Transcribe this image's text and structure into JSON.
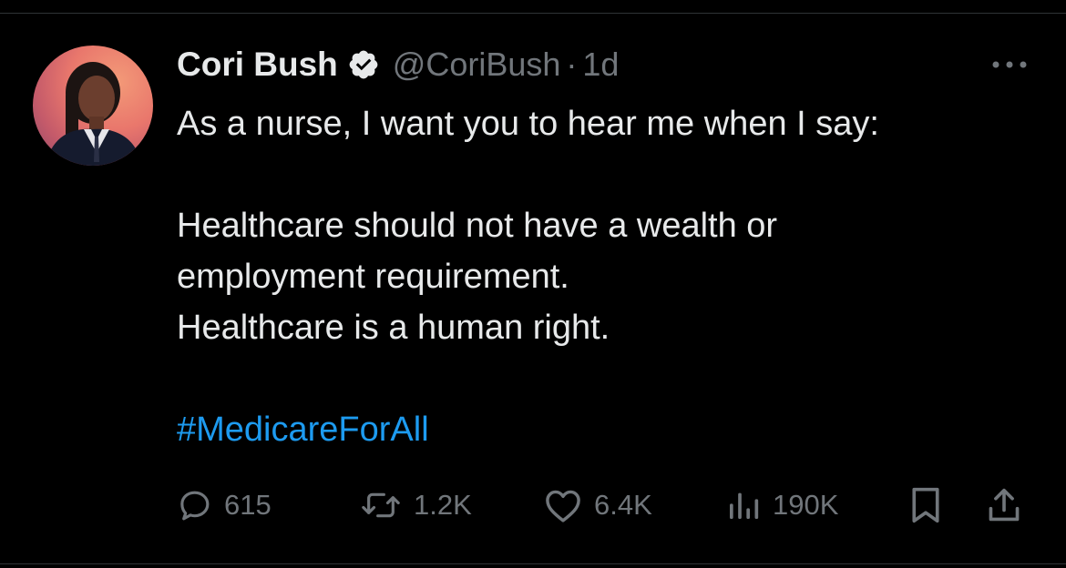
{
  "tweet": {
    "author_name": "Cori Bush",
    "handle": "@CoriBush",
    "separator": "·",
    "time": "1d",
    "lines": [
      "As a nurse, I want you to hear me when I say:",
      "",
      "Healthcare should not have a wealth or",
      "employment requirement.",
      "Healthcare is a human right.",
      ""
    ],
    "hashtag": "#MedicareForAll"
  },
  "actions": {
    "replies": "615",
    "reposts": "1.2K",
    "likes": "6.4K",
    "views": "190K"
  },
  "colors": {
    "background": "#000000",
    "text": "#e7e9ea",
    "muted": "#71767b",
    "accent": "#1d9bf0"
  },
  "icons": [
    "verified-badge-icon",
    "more-icon",
    "reply-icon",
    "repost-icon",
    "like-icon",
    "views-icon",
    "bookmark-icon",
    "share-icon"
  ]
}
